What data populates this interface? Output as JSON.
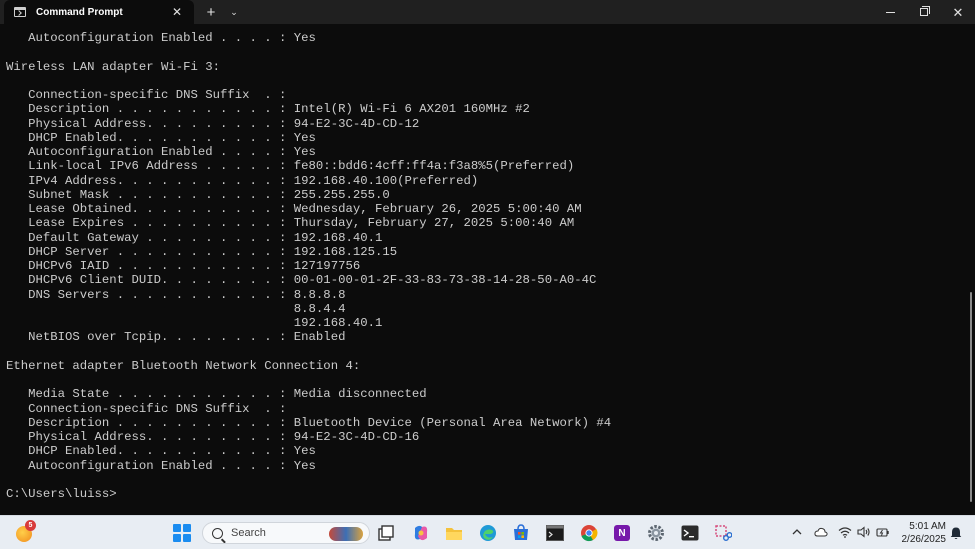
{
  "window": {
    "tab_title": "Command Prompt",
    "tab_close_glyph": "✕",
    "new_tab_glyph": "+",
    "dropdown_glyph": "⌄",
    "close_glyph": "✕"
  },
  "terminal": {
    "lines": [
      "   Autoconfiguration Enabled . . . . : Yes",
      "",
      "Wireless LAN adapter Wi-Fi 3:",
      "",
      "   Connection-specific DNS Suffix  . :",
      "   Description . . . . . . . . . . . : Intel(R) Wi-Fi 6 AX201 160MHz #2",
      "   Physical Address. . . . . . . . . : 94-E2-3C-4D-CD-12",
      "   DHCP Enabled. . . . . . . . . . . : Yes",
      "   Autoconfiguration Enabled . . . . : Yes",
      "   Link-local IPv6 Address . . . . . : fe80::bdd6:4cff:ff4a:f3a8%5(Preferred)",
      "   IPv4 Address. . . . . . . . . . . : 192.168.40.100(Preferred)",
      "   Subnet Mask . . . . . . . . . . . : 255.255.255.0",
      "   Lease Obtained. . . . . . . . . . : Wednesday, February 26, 2025 5:00:40 AM",
      "   Lease Expires . . . . . . . . . . : Thursday, February 27, 2025 5:00:40 AM",
      "   Default Gateway . . . . . . . . . : 192.168.40.1",
      "   DHCP Server . . . . . . . . . . . : 192.168.125.15",
      "   DHCPv6 IAID . . . . . . . . . . . : 127197756",
      "   DHCPv6 Client DUID. . . . . . . . : 00-01-00-01-2F-33-83-73-38-14-28-50-A0-4C",
      "   DNS Servers . . . . . . . . . . . : 8.8.8.8",
      "                                       8.8.4.4",
      "                                       192.168.40.1",
      "   NetBIOS over Tcpip. . . . . . . . : Enabled",
      "",
      "Ethernet adapter Bluetooth Network Connection 4:",
      "",
      "   Media State . . . . . . . . . . . : Media disconnected",
      "   Connection-specific DNS Suffix  . :",
      "   Description . . . . . . . . . . . : Bluetooth Device (Personal Area Network) #4",
      "   Physical Address. . . . . . . . . : 94-E2-3C-4D-CD-16",
      "   DHCP Enabled. . . . . . . . . . . : Yes",
      "   Autoconfiguration Enabled . . . . : Yes",
      "",
      "C:\\Users\\luiss>"
    ]
  },
  "taskbar": {
    "weather_badge": "5",
    "search_placeholder": "Search",
    "clock_time": "5:01 AM",
    "clock_date": "2/26/2025",
    "onenote_letter": "N",
    "icons": [
      "weather-icon",
      "start-icon",
      "search-icon",
      "task-view-icon",
      "copilot-icon",
      "file-explorer-icon",
      "edge-icon",
      "microsoft-store-icon",
      "command-prompt-icon",
      "chrome-icon",
      "onenote-icon",
      "settings-icon",
      "terminal-icon",
      "snipping-tool-icon"
    ],
    "tray": [
      "chevron-up-icon",
      "cloud-icon",
      "wifi-icon",
      "volume-icon",
      "battery-icon",
      "notification-bell-icon"
    ],
    "colors": {
      "taskbar_bg": "#e8edf3",
      "terminal_bg": "#0c0c0c",
      "terminal_text": "#cccccc",
      "titlebar_bg": "#202020"
    }
  }
}
